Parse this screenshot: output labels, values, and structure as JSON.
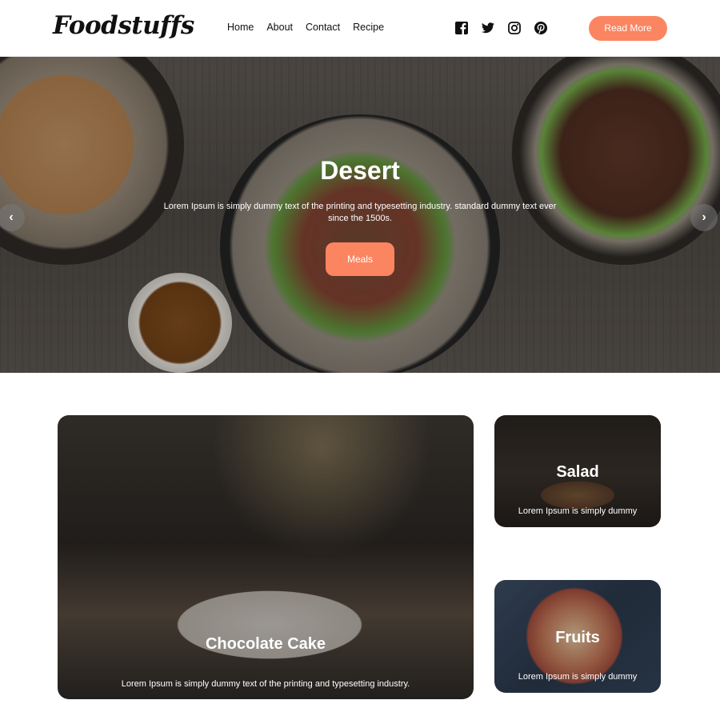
{
  "brand": {
    "logo": "Foodstuffs",
    "accent": "#fb8560"
  },
  "nav": {
    "links": [
      "Home",
      "About",
      "Contact",
      "Recipe"
    ],
    "socials": [
      "facebook-icon",
      "twitter-icon",
      "instagram-icon",
      "pinterest-icon"
    ],
    "cta_label": "Read More"
  },
  "hero": {
    "title": "Desert",
    "text": "Lorem Ipsum is simply dummy text of the printing and typesetting industry. standard dummy text ever since the 1500s.",
    "button_label": "Meals",
    "prev_arrow": "‹",
    "next_arrow": "›"
  },
  "cards": {
    "main": {
      "title": "Chocolate Cake",
      "text": "Lorem Ipsum is simply dummy text of the printing and typesetting industry."
    },
    "salad": {
      "title": "Salad",
      "text": "Lorem Ipsum is simply dummy"
    },
    "fruits": {
      "title": "Fruits",
      "text": "Lorem Ipsum is simply dummy"
    }
  }
}
